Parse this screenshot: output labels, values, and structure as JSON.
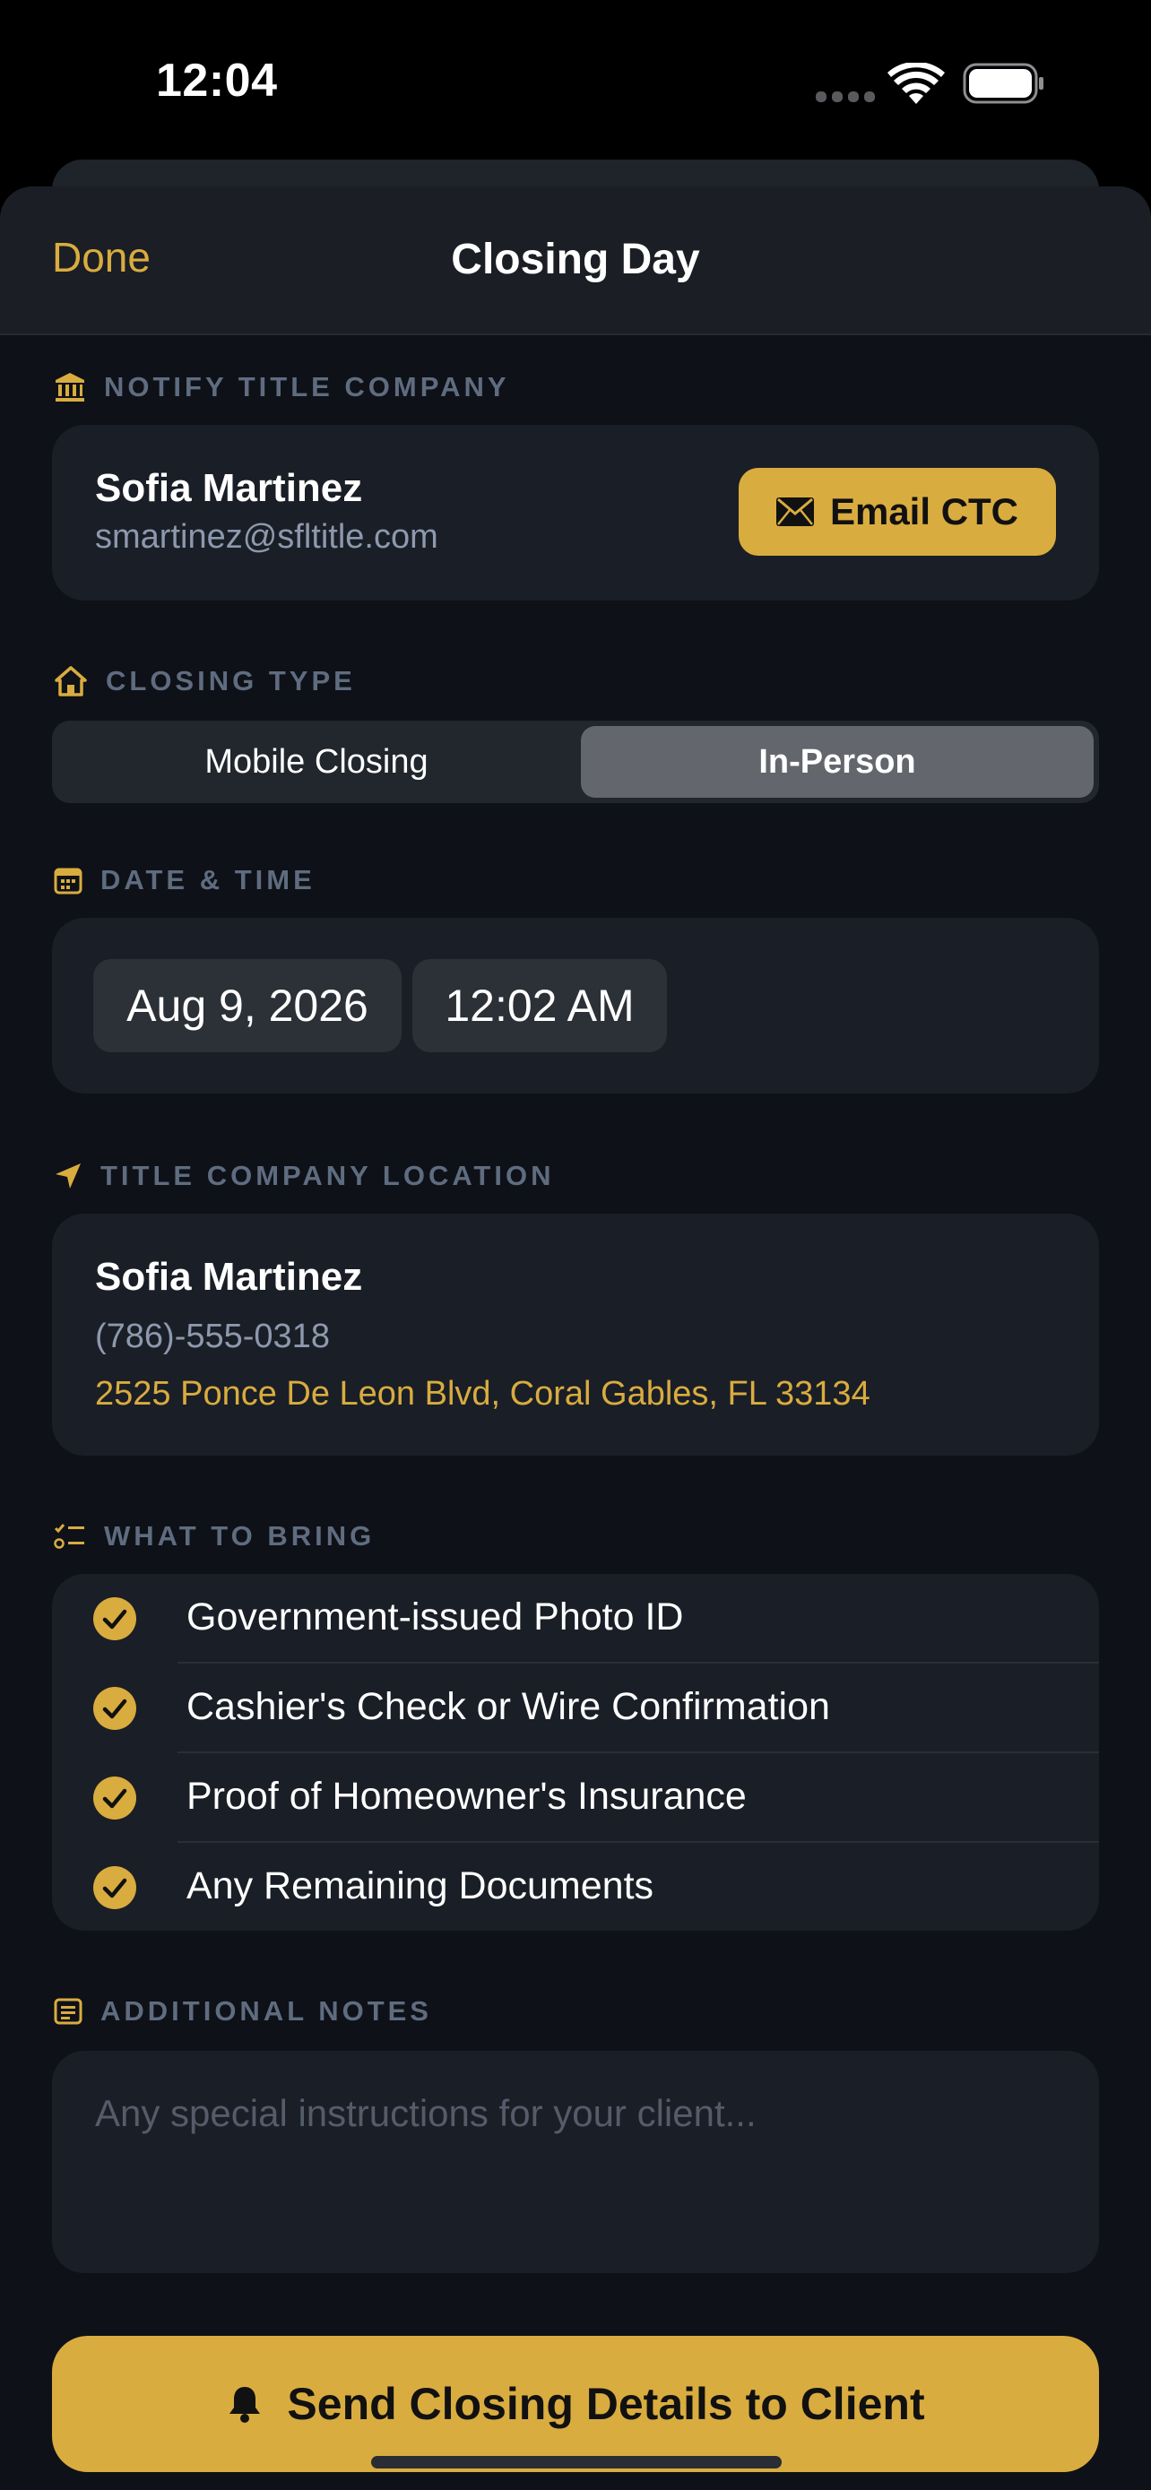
{
  "status_bar": {
    "time": "12:04"
  },
  "nav": {
    "done_label": "Done",
    "title": "Closing Day"
  },
  "notify": {
    "header": "NOTIFY TITLE COMPANY",
    "contact_name": "Sofia Martinez",
    "contact_email": "smartinez@sfltitle.com",
    "email_button_label": "Email CTC"
  },
  "closing_type": {
    "header": "CLOSING TYPE",
    "options": [
      "Mobile Closing",
      "In-Person"
    ],
    "selected": "In-Person"
  },
  "date_time": {
    "header": "DATE & TIME",
    "date": "Aug 9, 2026",
    "time": "12:02 AM"
  },
  "location": {
    "header": "TITLE COMPANY LOCATION",
    "name": "Sofia Martinez",
    "phone": "(786)-555-0318",
    "address": "2525 Ponce De Leon Blvd, Coral Gables, FL 33134"
  },
  "bring": {
    "header": "WHAT TO BRING",
    "items": [
      "Government-issued Photo ID",
      "Cashier's Check or Wire Confirmation",
      "Proof of Homeowner's Insurance",
      "Any Remaining Documents"
    ]
  },
  "notes": {
    "header": "ADDITIONAL NOTES",
    "placeholder": "Any special instructions for your client...",
    "value": ""
  },
  "send_button_label": "Send Closing Details to Client",
  "colors": {
    "accent": "#d9ac3f",
    "background": "#0e1117",
    "card": "#1a1e26",
    "section_header": "#5f6c80"
  }
}
